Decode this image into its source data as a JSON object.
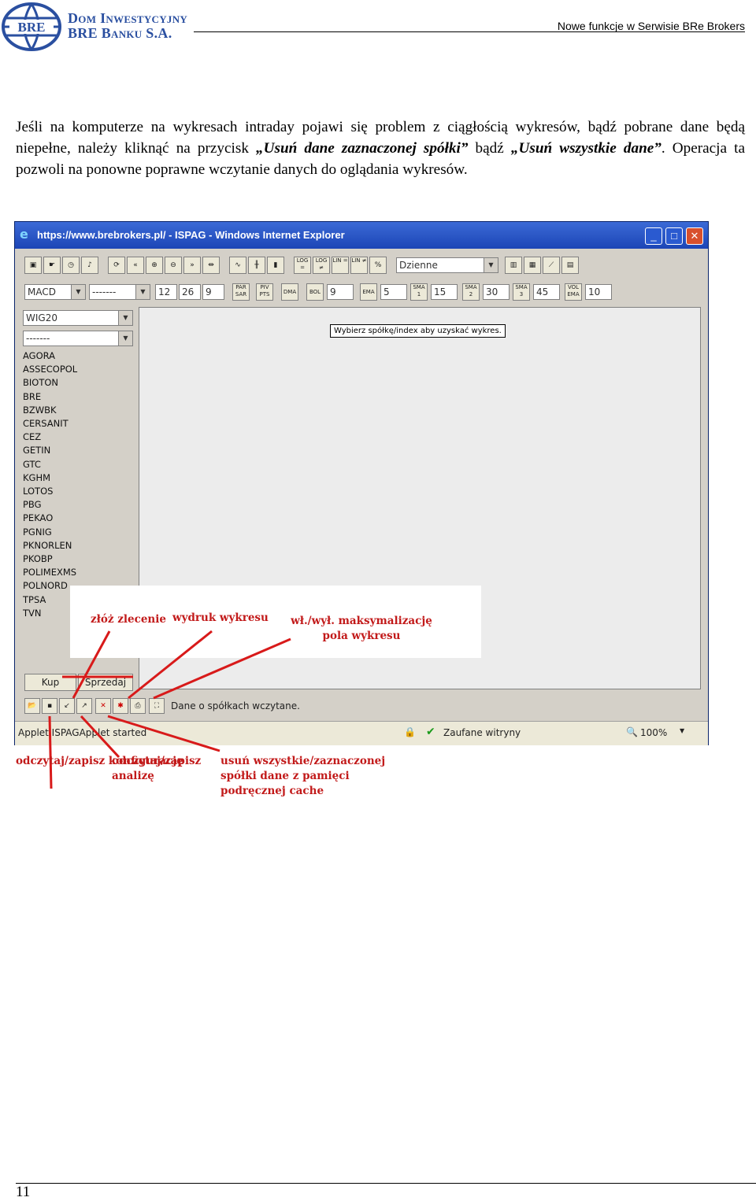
{
  "header": {
    "logo_line1": "Dom Inwestycyjny",
    "logo_line2": "BRE Banku S.A.",
    "right_text": "Nowe funkcje w Serwisie BRe Brokers"
  },
  "paragraph": {
    "part1": "Jeśli na komputerze na wykresach intraday pojawi się problem z ciągłością wykresów, bądź pobrane dane będą niepełne, należy kliknąć na przycisk ",
    "em1": "„Usuń dane zaznaczonej spółki”",
    "part2": " bądź ",
    "em2": "„Usuń wszystkie dane”",
    "part3": ". Operacja ta pozwoli na ponowne poprawne wczytanie danych do oglądania wykresów."
  },
  "browser": {
    "title": "https://www.brebrokers.pl/ - ISPAG - Windows Internet Explorer",
    "min": "_",
    "max": "□",
    "close": "✕"
  },
  "toolbar": {
    "period": "Dzienne",
    "indicator": "MACD",
    "indicator2": "-------",
    "p1": "12",
    "p2": "26",
    "p3": "9",
    "par_sar": "PAR SAR",
    "piv_pts": "PIV PTS",
    "dma": "DMA",
    "bol": "BOL",
    "bol_val": "9",
    "ema": "EMA",
    "ema_val": "5",
    "sma1": "SMA 1",
    "sma1_val": "15",
    "sma2": "SMA 2",
    "sma2_val": "30",
    "sma3": "SMA 3",
    "sma3_val": "45",
    "vol_ema": "VOL EMA",
    "vol_val": "10",
    "log_eq": "LOG =",
    "log_neq": "LOG ≠",
    "lin_eq": "LIN =",
    "lin_neq": "LIN ≠",
    "pct": "%"
  },
  "sidebar": {
    "index": "WIG20",
    "filter": "-------",
    "stocks": [
      "AGORA",
      "ASSECOPOL",
      "BIOTON",
      "BRE",
      "BZWBK",
      "CERSANIT",
      "CEZ",
      "GETIN",
      "GTC",
      "KGHM",
      "LOTOS",
      "PBG",
      "PEKAO",
      "PGNIG",
      "PKNORLEN",
      "PKOBP",
      "POLIMEXMS",
      "POLNORD",
      "TPSA",
      "TVN"
    ],
    "buy": "Kup",
    "sell": "Sprzedaj"
  },
  "chart": {
    "hint": "Wybierz spółkę/index aby uzyskać wykres."
  },
  "status": {
    "bottom_msg": "Dane o spółkach wczytane.",
    "applet": "Applet ISPAGApplet started",
    "zone": "Zaufane witryny",
    "zoom": "100%"
  },
  "annotations": {
    "order": "złóż zlecenie",
    "print": "wydruk wykresu",
    "maximize": "wł./wył. maksymalizację pola wykresu",
    "config": "odczytaj/zapisz konfigurację",
    "analysis": "odczytaj/zapisz analizę",
    "delete": "usuń wszystkie/zaznaczonej spółki dane z pamięci podręcznej cache"
  },
  "page_number": "11",
  "colors": {
    "annotation": "#c21a1a",
    "logo": "#2a4fa0",
    "titlebar": "#1c45b6"
  }
}
